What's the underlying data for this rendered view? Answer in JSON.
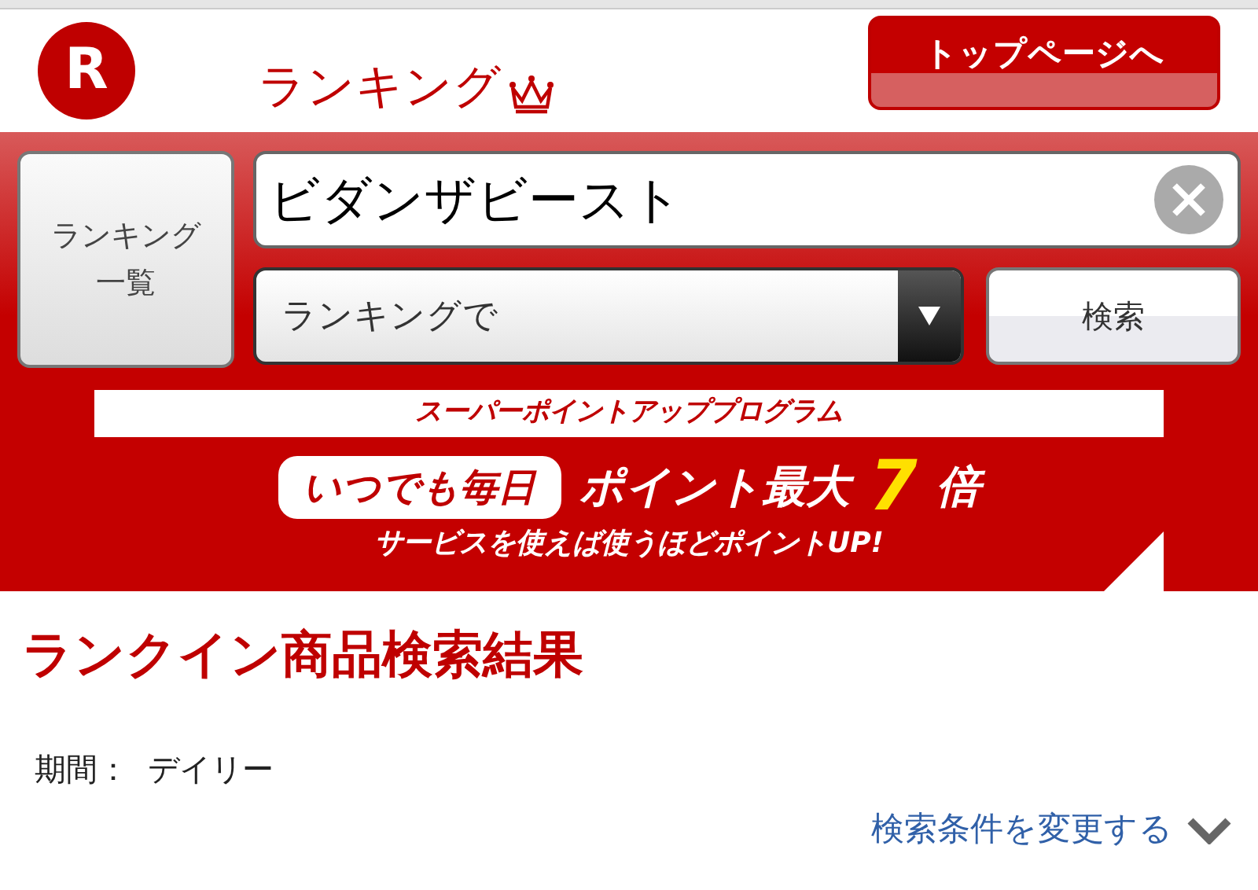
{
  "header": {
    "logo": "R",
    "title": "ランキング",
    "top_button": "トップページへ"
  },
  "search": {
    "list_button": "ランキング一覧",
    "value": "ビダンザビースト",
    "scope": "ランキングで",
    "search_button": "検索"
  },
  "banner": {
    "heading": "スーパーポイントアッププログラム",
    "pill": "いつでも毎日",
    "headline": "ポイント最大",
    "number": "7",
    "suffix": "倍",
    "subline": "サービスを使えば使うほどポイントUP!"
  },
  "results": {
    "title": "ランクイン商品検索結果",
    "period_label": "期間：",
    "period_value": "デイリー",
    "change_link": "検索条件を変更する"
  }
}
